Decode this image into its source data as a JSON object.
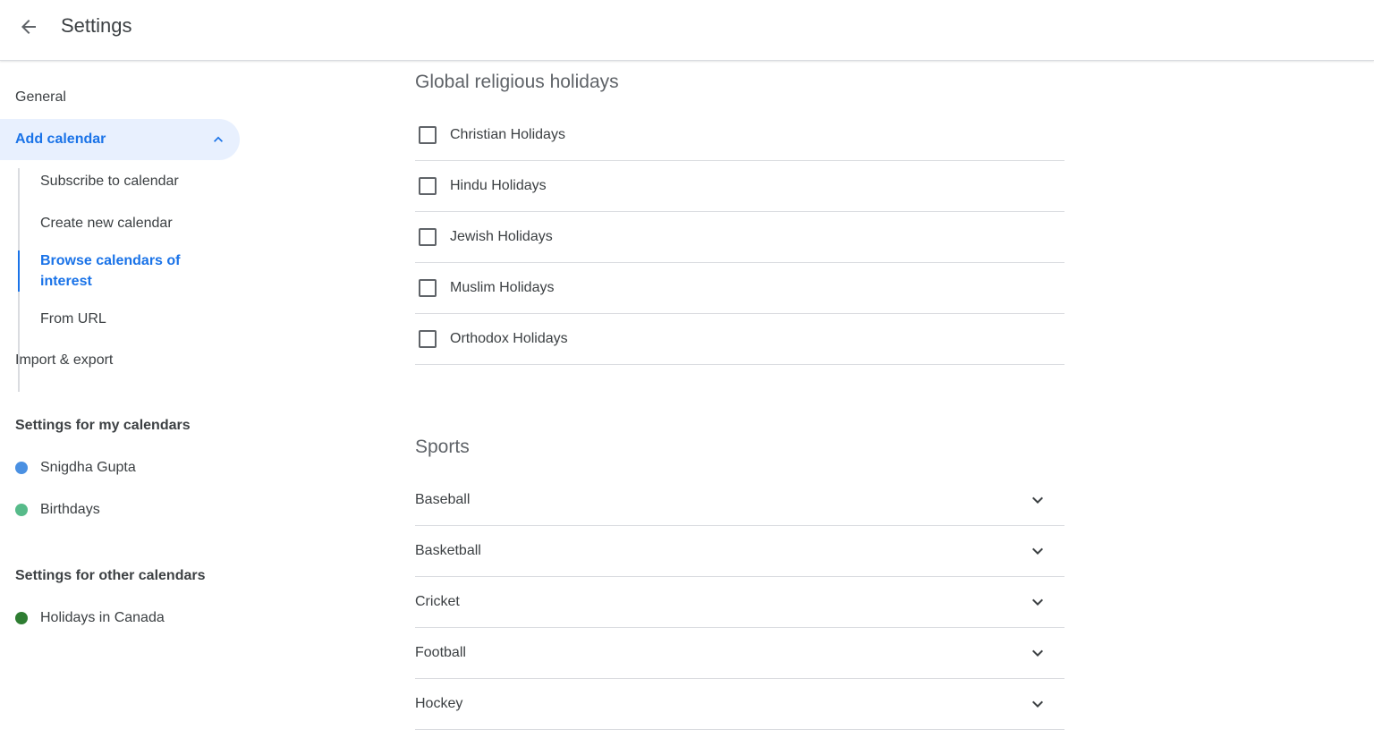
{
  "header": {
    "title": "Settings"
  },
  "sidebar": {
    "general": "General",
    "add_calendar": "Add calendar",
    "sub_items": [
      "Subscribe to calendar",
      "Create new calendar",
      "Browse calendars of interest",
      "From URL"
    ],
    "import_export": "Import & export",
    "my_calendars_heading": "Settings for my calendars",
    "my_calendars": [
      {
        "name": "Snigdha Gupta",
        "color": "#4a90e2"
      },
      {
        "name": "Birthdays",
        "color": "#57bb8a"
      }
    ],
    "other_calendars_heading": "Settings for other calendars",
    "other_calendars": [
      {
        "name": "Holidays in Canada",
        "color": "#2e7d32"
      }
    ]
  },
  "main": {
    "religious": {
      "title": "Global religious holidays",
      "items": [
        "Christian Holidays",
        "Hindu Holidays",
        "Jewish Holidays",
        "Muslim Holidays",
        "Orthodox Holidays"
      ]
    },
    "sports": {
      "title": "Sports",
      "items": [
        "Baseball",
        "Basketball",
        "Cricket",
        "Football",
        "Hockey"
      ]
    }
  },
  "colors": {
    "accent": "#1a73e8",
    "active_bg": "#e8f0fe",
    "divider": "#dadce0"
  }
}
